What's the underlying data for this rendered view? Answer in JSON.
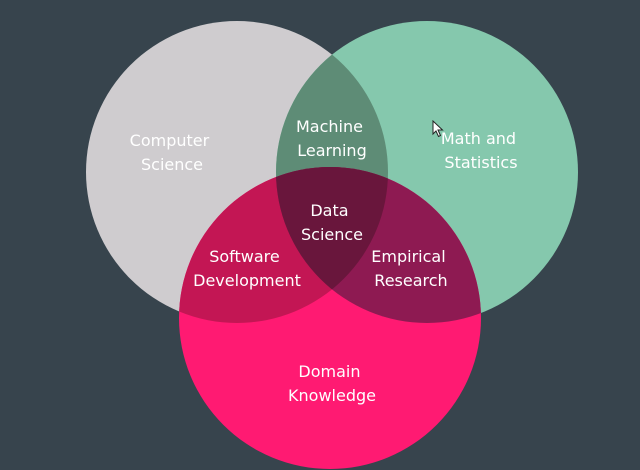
{
  "diagram": {
    "colors": {
      "background": "#37444d",
      "computer_science": "#cfcccf",
      "math_statistics": "#85c8ad",
      "domain_knowledge": "#ff1a72",
      "cs_math": "#5e8c76",
      "cs_domain": "#c31654",
      "math_domain": "#8e1a52",
      "center": "#69163c"
    },
    "sets": {
      "computer_science": [
        "Computer",
        "Science"
      ],
      "math_statistics": [
        "Math and",
        "Statistics"
      ],
      "domain_knowledge": [
        "Domain",
        "Knowledge"
      ]
    },
    "intersections": {
      "machine_learning": [
        "Machine",
        "Learning"
      ],
      "software_development": [
        "Software",
        "Development"
      ],
      "empirical_research": [
        "Empirical",
        "Research"
      ],
      "data_science": [
        "Data",
        "Science"
      ]
    }
  },
  "cursor_icon": "mouse-pointer-icon"
}
